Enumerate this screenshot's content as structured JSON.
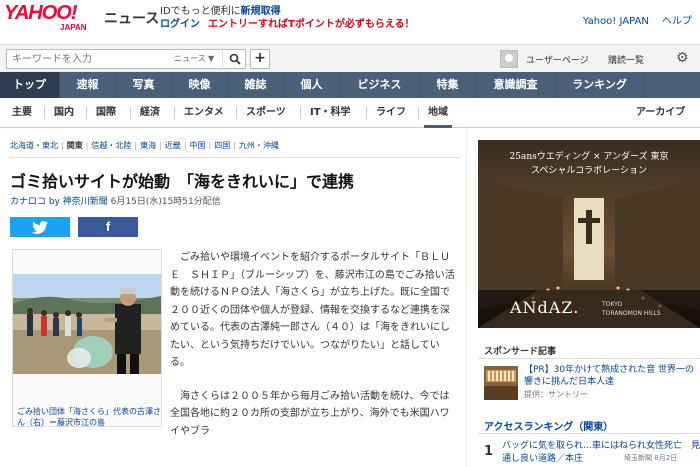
{
  "header": {
    "logo_text": "YAHOO!",
    "logo_sub": "JAPAN",
    "section_label": "ニュース",
    "promo_line1_prefix": "IDでもっと便利に",
    "promo_line1_link": "新規取得",
    "promo_login": "ログイン",
    "promo_points": "エントリーすればTポイントが必ずもらえる！",
    "top_links": [
      "Yahoo! JAPAN",
      "ヘルプ"
    ]
  },
  "search": {
    "placeholder": "キーワードを入力",
    "scope": "ニュース",
    "user_page": "ユーザーページ",
    "subscribe": "購読一覧"
  },
  "main_nav": [
    {
      "label": "トップ",
      "active": true
    },
    {
      "label": "速報"
    },
    {
      "label": "写真"
    },
    {
      "label": "映像"
    },
    {
      "label": "雑誌"
    },
    {
      "label": "個人"
    },
    {
      "label": "ビジネス"
    },
    {
      "label": "特集"
    },
    {
      "label": "意識調査"
    },
    {
      "label": "ランキング"
    }
  ],
  "sub_nav": [
    {
      "label": "主要"
    },
    {
      "label": "国内"
    },
    {
      "label": "国際"
    },
    {
      "label": "経済"
    },
    {
      "label": "エンタメ"
    },
    {
      "label": "スポーツ"
    },
    {
      "label": "IT・科学"
    },
    {
      "label": "ライフ"
    },
    {
      "label": "地域",
      "active": true
    }
  ],
  "sub_nav_archive": "アーカイブ",
  "region_nav": [
    {
      "label": "北海道・東北"
    },
    {
      "label": "関東",
      "current": true
    },
    {
      "label": "信越・北陸"
    },
    {
      "label": "東海"
    },
    {
      "label": "近畿"
    },
    {
      "label": "中国"
    },
    {
      "label": "四国"
    },
    {
      "label": "九州・沖縄"
    }
  ],
  "article": {
    "headline": "ゴミ拾いサイトが始動　「海をきれいに」で連携",
    "source": "カナロコ by 神奈川新聞",
    "date": "6月15日(水)15時51分配信",
    "facebook_label": "f",
    "caption": "ごみ拾い団体「海さくら」代表の古澤さん（右）＝藤沢市江の島",
    "paragraph1": "ごみ拾いや環境イベントを紹介するポータルサイト「ＢＬＵＥ　ＳＨＩＰ」（ブルーシップ）を、藤沢市江の島でごみ拾い活動を続けるＮＰＯ法人「海さくら」が立ち上げた。既に全国で２００近くの団体や個人が登録、情報を交換するなど連携を深めている。代表の古澤純一郎さん（４０）は「海をきれいにしたい、という気持ちだけでいい。つながりたい」と話している。",
    "paragraph2": "海さくらは２００５年から毎月ごみ拾い活動を続け、今では全国各地に約２０カ所の支部が立ち上がり、海外でも米国ハワイやブラ"
  },
  "ad": {
    "line1": "25ansウエディング × アンダーズ 東京",
    "line2": "スペシャルコラボレーション",
    "brand": "ANdAZ.",
    "location_line1": "TOKYO",
    "location_line2": "TORANOMON HILLS"
  },
  "sponsor": {
    "heading": "スポンサード記事",
    "title": "【PR】30年かけて熟成された音 世界一の響きに挑んだ日本人達",
    "provider": "提供：サントリー"
  },
  "ranking": {
    "heading": "アクセスランキング（関東）",
    "items": [
      {
        "rank": "1",
        "title": "バッグに気を取られ…車にはねられ女性死亡　見通し良い道路／本庄",
        "source": "埼玉新聞",
        "date": "8月2日"
      }
    ]
  },
  "colors": {
    "nav_bg": "#4a5f78",
    "yahoo_red": "#ff0033",
    "link_blue": "#0047a8",
    "twitter": "#1da1f2",
    "facebook": "#3b5998"
  }
}
